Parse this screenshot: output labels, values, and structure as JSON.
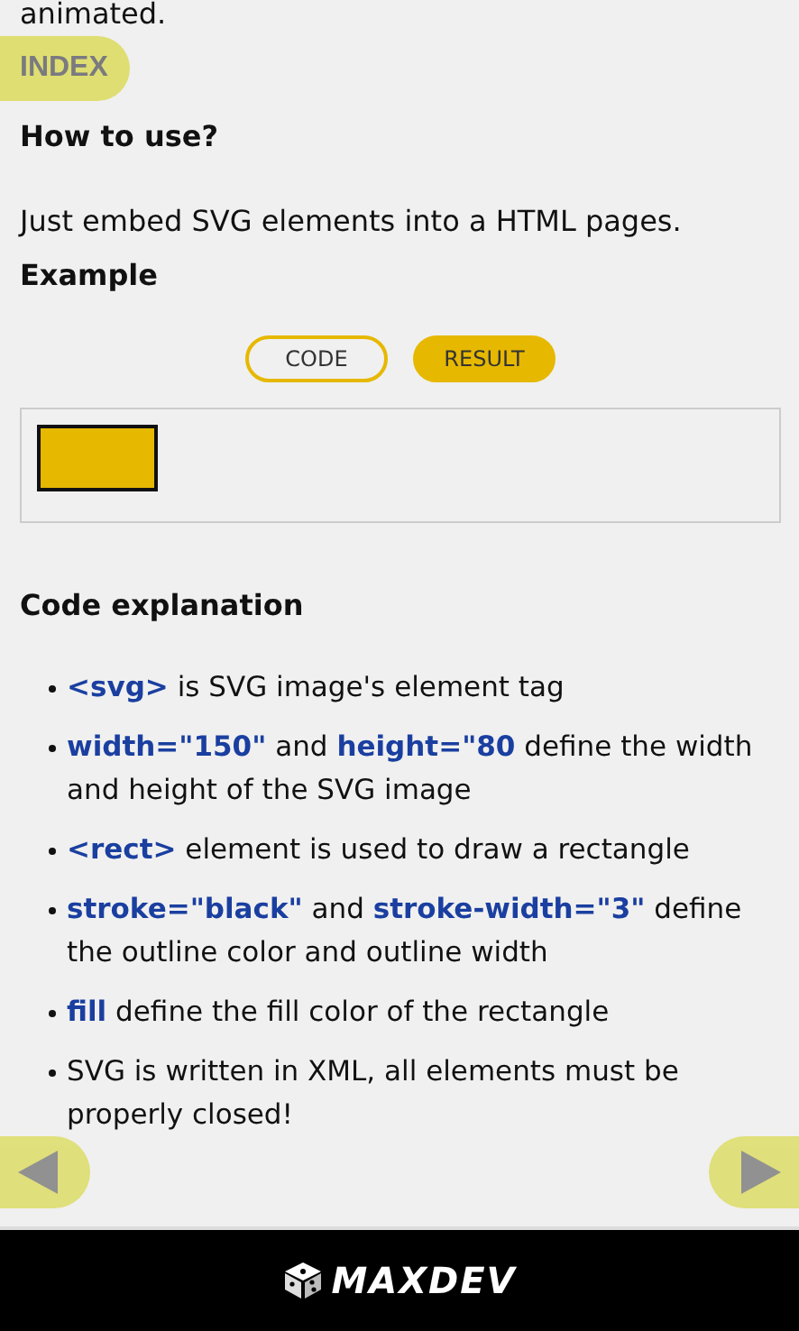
{
  "intro_tail": "animated.",
  "index_button": {
    "label": "INDEX"
  },
  "sections": [
    {
      "heading": "How to use?",
      "text": "Just embed SVG elements into a HTML pages."
    }
  ],
  "example": {
    "heading": "Example",
    "tabs": [
      {
        "label": "CODE",
        "selected": false
      },
      {
        "label": "RESULT",
        "selected": true
      }
    ],
    "result": {
      "kind": "rectangle"
    }
  },
  "explanation": {
    "heading": "Code explanation",
    "bullets": [
      "**<svg>** is SVG image's element tag",
      "**width=\"150\"** and **height=\"80** define the width and height of the SVG image",
      "**<rect>** element is used to draw a rectangle",
      "**stroke=\"black\"** and **stroke-width=\"3\"** define the outline color and outline width",
      "**fill** define the fill color of the rectangle",
      "SVG is written in XML, all elements must be properly closed!"
    ]
  },
  "footer": {
    "logo": "MAXDEV"
  }
}
